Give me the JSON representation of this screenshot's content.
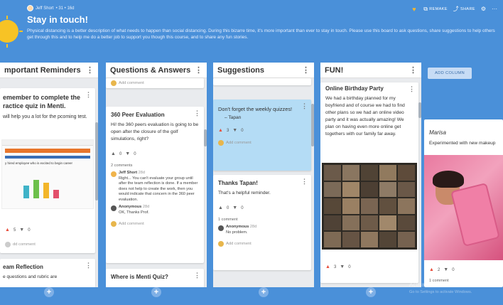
{
  "header": {
    "author": "Jeff Short",
    "meta_rest": "• 31 • 16d",
    "title": "Stay in touch!",
    "description": "Physical distancing is a better description of what needs to happen than social distancing. During this bizarre time, it's more important than ever to stay in touch. Please use this board to ask questions, share suggestions to help others get through this and to help me do a better job to support you though this course, and to share any fun stories.",
    "remake_label": "REMAKE",
    "share_label": "SHARE",
    "more_label": "···"
  },
  "add_column_label": "ADD COLUMN",
  "columns": [
    {
      "title": "mportant Reminders",
      "cards": [
        {
          "title": "emember to complete the ractice quiz in Menti.",
          "body": "will help you a lot for the pcoming test.",
          "likes": "5",
          "dislikes": "0",
          "add_comment": "dd comment"
        },
        {
          "title": "eam Reflection",
          "body": "e questions and rubric are"
        }
      ],
      "embedded_chart_caption": "y hired employee who is excited to begin career"
    },
    {
      "title": "Questions & Answers",
      "top_add_comment": "Add comment",
      "cards": [
        {
          "title": "360 Peer Evaluation",
          "body": "Hi! the 360 peers evaluation is going to be open after the closure of the golf simulations, right?",
          "likes": "0",
          "dislikes": "0",
          "comments_count": "2 comments",
          "comments": [
            {
              "author": "Jeff Short",
              "time": "28d",
              "text": "Right... You can't evaluate your group until after the team reflection is done. If a member does not help to create the work, then you would indicate that concern in the 360 peer evaluation."
            },
            {
              "author": "Anonymous",
              "time": "28d",
              "text": "OK, Thanks Prof."
            }
          ],
          "add_comment": "Add comment"
        },
        {
          "title": "Where is Menti Quiz?"
        }
      ]
    },
    {
      "title": "Suggestions",
      "cards": [
        {
          "title": "Don't forget the weekly quizzes!",
          "body": "– Tapan",
          "likes": "3",
          "dislikes": "0",
          "add_comment": "Add comment"
        },
        {
          "title": "Thanks Tapan!",
          "body": "That's a helpful reminder.",
          "likes": "0",
          "dislikes": "0",
          "comments_count": "1 comment",
          "comments": [
            {
              "author": "Anonymous",
              "time": "28d",
              "text": "No problem."
            }
          ],
          "add_comment": "Add comment"
        }
      ]
    },
    {
      "title": "FUN!",
      "cards": [
        {
          "title": "Online Birthday Party",
          "body": "We had a birthday planned for my boyfriend and of course we had to find other plans so we had an online video party and it was actually amazing! We plan on having even more online get togethers with our family far away.",
          "likes": "3",
          "dislikes": "0"
        }
      ]
    },
    {
      "title": "",
      "cards": [
        {
          "author": "Marisa",
          "body": "Experimented with new makeup",
          "likes": "2",
          "dislikes": "0",
          "comments_count": "1 comment"
        }
      ]
    }
  ],
  "watermark": {
    "title": "Activate Windows",
    "sub": "Go to Settings to activate Windows."
  },
  "colors": {
    "background": "#4a90d9",
    "accent_yellow": "#f7c325",
    "highlight_card": "#b4dcf5",
    "like_red": "#e84e3c"
  }
}
